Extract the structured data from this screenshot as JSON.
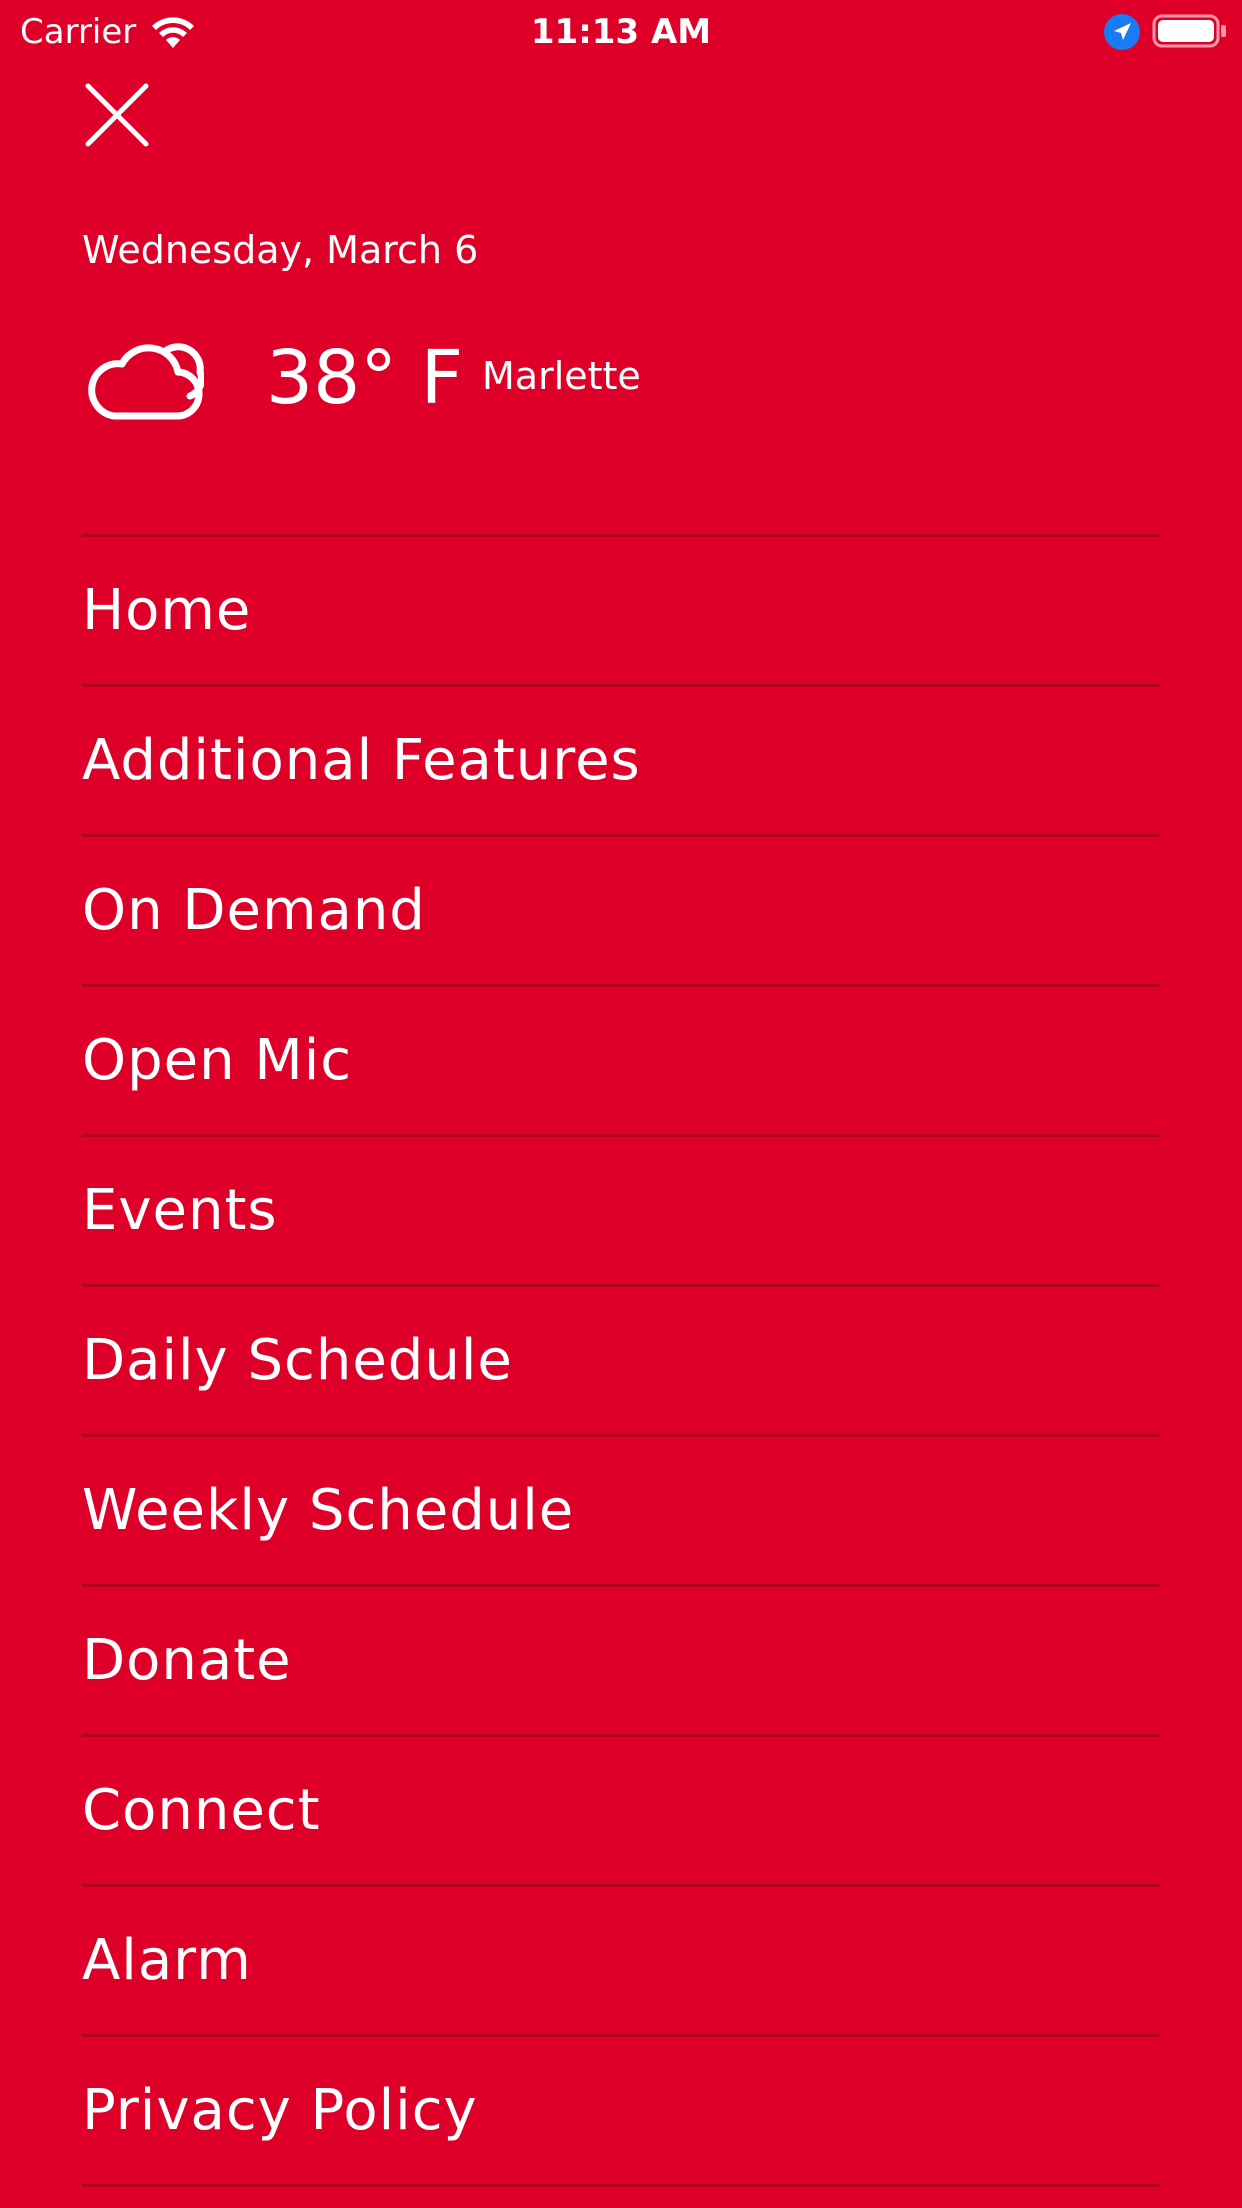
{
  "status_bar": {
    "carrier": "Carrier",
    "time": "11:13 AM"
  },
  "header": {
    "date": "Wednesday, March 6",
    "temperature": "38° F",
    "location": "Marlette",
    "weather_icon": "cloudy-icon"
  },
  "menu": {
    "items": [
      {
        "label": "Home"
      },
      {
        "label": "Additional Features"
      },
      {
        "label": "On Demand"
      },
      {
        "label": "Open Mic"
      },
      {
        "label": "Events"
      },
      {
        "label": "Daily Schedule"
      },
      {
        "label": "Weekly Schedule"
      },
      {
        "label": "Donate"
      },
      {
        "label": "Connect"
      },
      {
        "label": "Alarm"
      },
      {
        "label": "Privacy Policy"
      }
    ]
  },
  "colors": {
    "background": "#df0029",
    "text": "#ffffff",
    "location_arrow": "#1a7cf5"
  }
}
